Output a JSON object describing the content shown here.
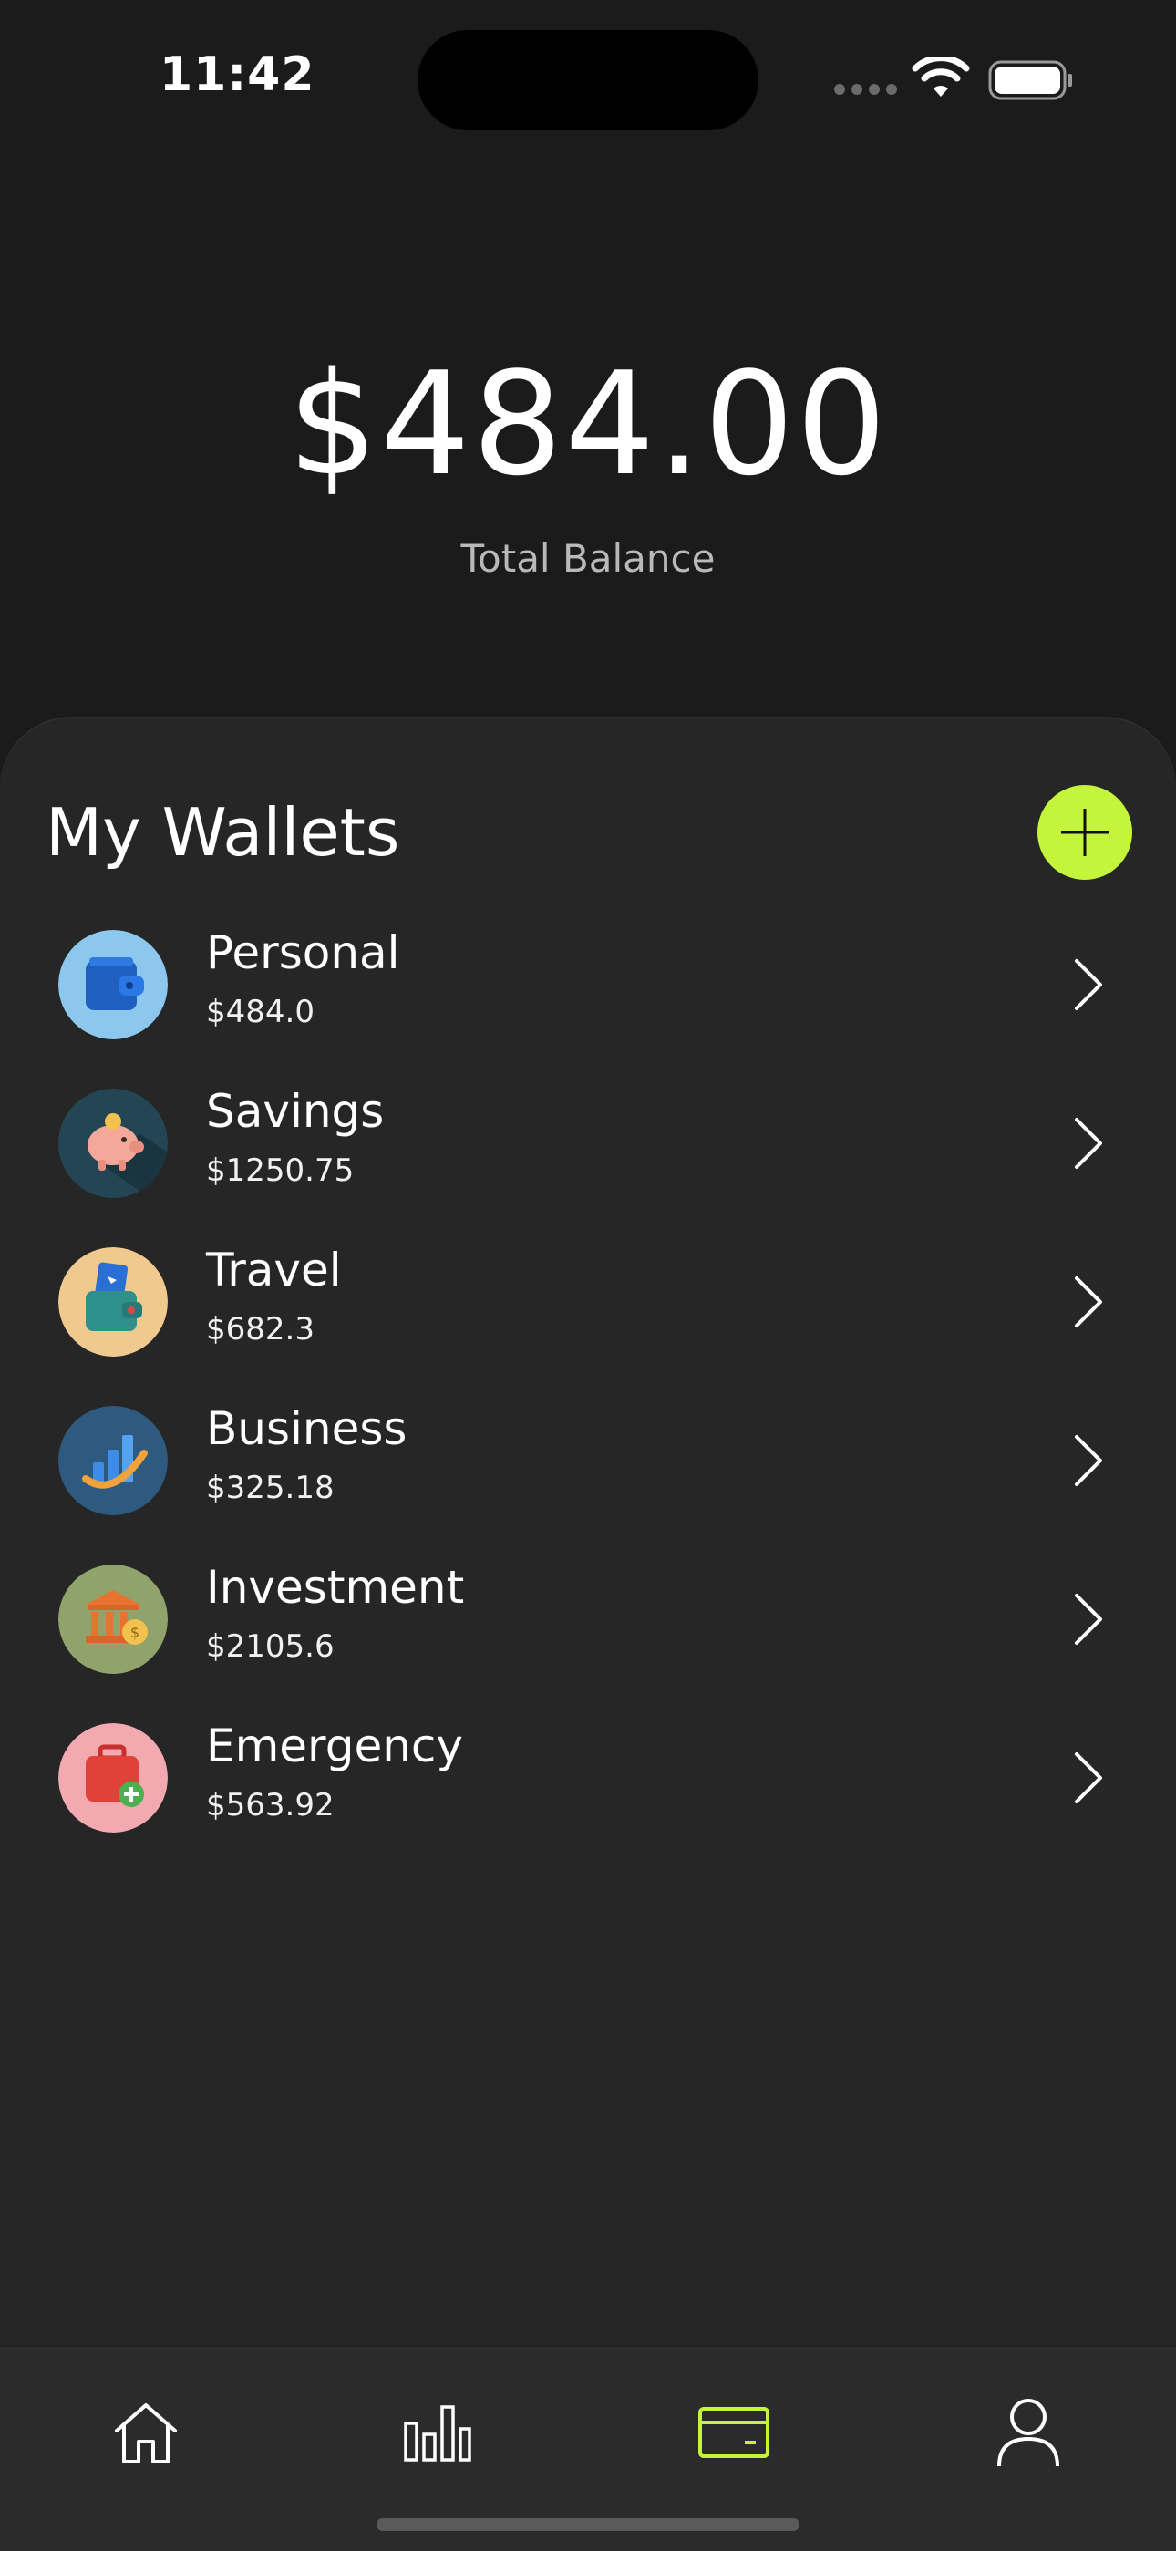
{
  "status_bar": {
    "time": "11:42"
  },
  "header": {
    "balance": "$484.00",
    "balance_label": "Total Balance"
  },
  "wallets": {
    "title": "My Wallets",
    "add_button_icon": "plus-icon",
    "accent_color": "#c4f53b",
    "items": [
      {
        "name": "Personal",
        "amount": "$484.0",
        "icon": "wallet-icon",
        "avatar_color": "#8cc8ee"
      },
      {
        "name": "Savings",
        "amount": "$1250.75",
        "icon": "piggy-bank-icon",
        "avatar_color": "#244654"
      },
      {
        "name": "Travel",
        "amount": "$682.3",
        "icon": "travel-wallet-icon",
        "avatar_color": "#f0c98f"
      },
      {
        "name": "Business",
        "amount": "$325.18",
        "icon": "bar-chart-growth-icon",
        "avatar_color": "#2e5a80"
      },
      {
        "name": "Investment",
        "amount": "$2105.6",
        "icon": "bank-coin-icon",
        "avatar_color": "#8fa36b"
      },
      {
        "name": "Emergency",
        "amount": "$563.92",
        "icon": "first-aid-kit-icon",
        "avatar_color": "#f2a9b0"
      }
    ]
  },
  "tab_bar": {
    "tabs": [
      {
        "id": "home",
        "icon": "home-icon",
        "active": false
      },
      {
        "id": "stats",
        "icon": "bar-chart-icon",
        "active": false
      },
      {
        "id": "wallets",
        "icon": "credit-card-icon",
        "active": true
      },
      {
        "id": "profile",
        "icon": "user-icon",
        "active": false
      }
    ],
    "active_color": "#c4f53b",
    "inactive_color": "#ffffff"
  }
}
